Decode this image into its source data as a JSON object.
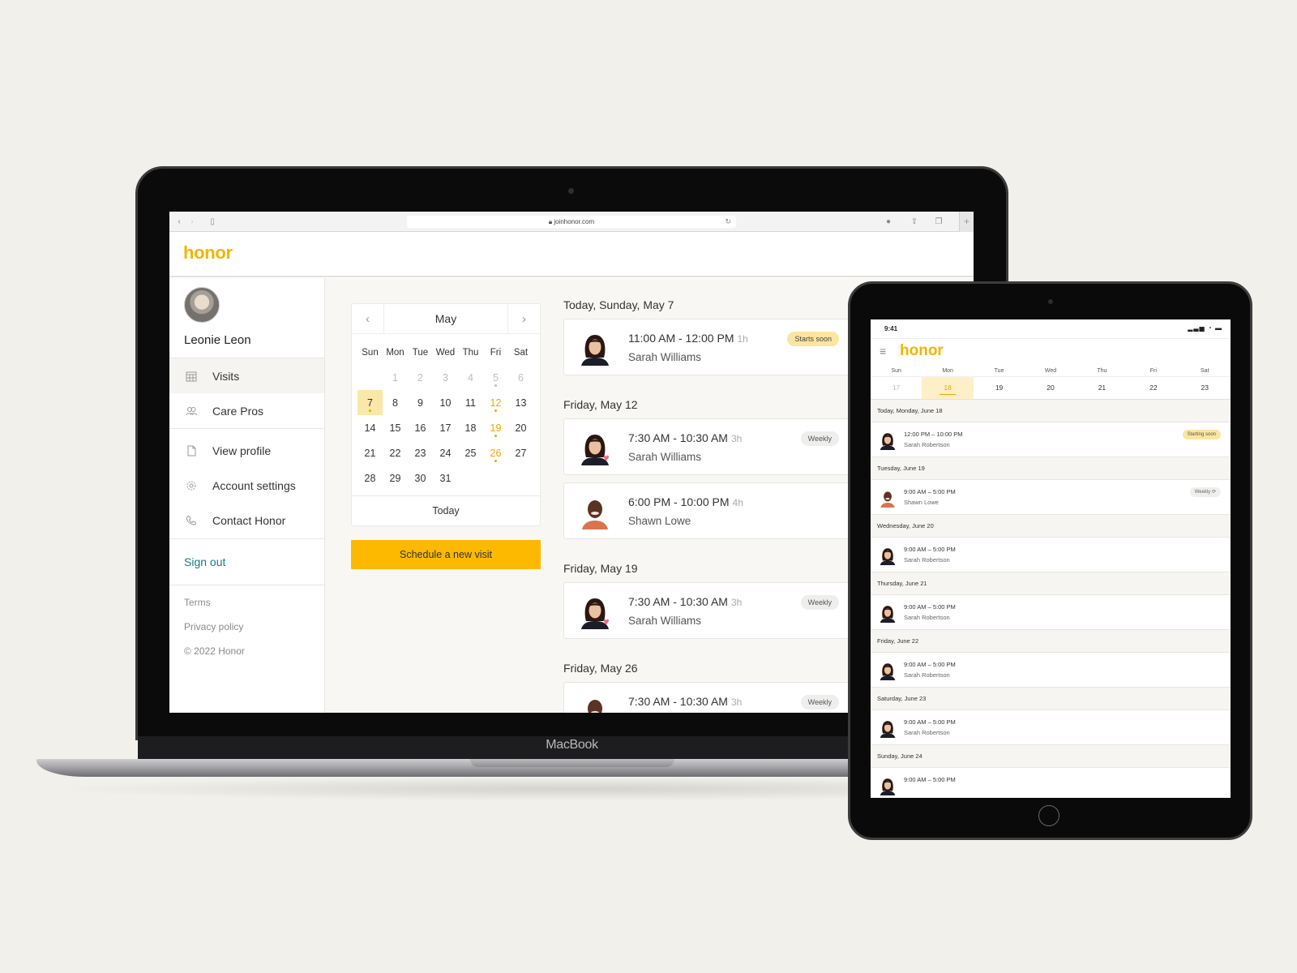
{
  "laptop": {
    "brand_label": "MacBook",
    "browser": {
      "url": "joinhonor.com",
      "lock_icon": "lock-icon",
      "back_icon": "chevron-left-icon",
      "forward_icon": "chevron-right-icon",
      "sidebar_icon": "sidebar-icon",
      "reload_icon": "reload-icon",
      "download_icon": "download-icon",
      "share_icon": "share-icon",
      "tabs_icon": "tabs-icon",
      "new_tab": "+"
    },
    "app": {
      "logo": "honor",
      "brand_color": "#f5b400",
      "user": {
        "name": "Leonie Leon"
      },
      "nav_primary": [
        {
          "label": "Visits",
          "icon": "calendar-icon",
          "active": true
        },
        {
          "label": "Care Pros",
          "icon": "people-icon",
          "active": false
        }
      ],
      "nav_secondary": [
        {
          "label": "View profile",
          "icon": "document-icon"
        },
        {
          "label": "Account settings",
          "icon": "gear-icon"
        },
        {
          "label": "Contact Honor",
          "icon": "phone-icon"
        }
      ],
      "sign_out": "Sign out",
      "footer": {
        "terms": "Terms",
        "privacy": "Privacy policy",
        "copyright": "© 2022 Honor"
      },
      "calendar": {
        "month": "May",
        "prev": "‹",
        "next": "›",
        "weekdays": [
          "Sun",
          "Mon",
          "Tue",
          "Wed",
          "Thu",
          "Fri",
          "Sat"
        ],
        "today_label": "Today",
        "selected_day": 7,
        "visit_days": [
          7,
          12,
          19,
          26
        ],
        "past_visit_days": [
          5
        ]
      },
      "schedule_button": "Schedule a new visit",
      "visit_days": [
        {
          "label": "Today, Sunday, May 7",
          "visits": [
            {
              "time": "11:00 AM - 12:00 PM",
              "duration": "1h",
              "carepro": "Sarah Williams",
              "badge": "Starts soon",
              "badge_type": "soon",
              "favorite": false,
              "avatar": "f"
            }
          ]
        },
        {
          "label": "Friday, May 12",
          "visits": [
            {
              "time": "7:30 AM - 10:30 AM",
              "duration": "3h",
              "carepro": "Sarah Williams",
              "badge": "Weekly",
              "badge_type": "weekly",
              "favorite": true,
              "avatar": "f"
            },
            {
              "time": "6:00 PM - 10:00 PM",
              "duration": "4h",
              "carepro": "Shawn Lowe",
              "badge": "",
              "badge_type": "",
              "favorite": false,
              "avatar": "m"
            }
          ]
        },
        {
          "label": "Friday, May 19",
          "visits": [
            {
              "time": "7:30 AM - 10:30 AM",
              "duration": "3h",
              "carepro": "Sarah Williams",
              "badge": "Weekly",
              "badge_type": "weekly",
              "favorite": true,
              "avatar": "f"
            }
          ]
        },
        {
          "label": "Friday, May 26",
          "visits": [
            {
              "time": "7:30 AM - 10:30 AM",
              "duration": "3h",
              "carepro": "",
              "badge": "Weekly",
              "badge_type": "weekly",
              "favorite": false,
              "avatar": "m"
            }
          ]
        }
      ]
    }
  },
  "tablet": {
    "status_time": "9:41",
    "status_icons": "signal-icon wifi-icon battery-icon",
    "logo": "honor",
    "menu_icon": "hamburger-icon",
    "week": {
      "weekdays": [
        "Sun",
        "Mon",
        "Tue",
        "Wed",
        "Thu",
        "Fri",
        "Sat"
      ],
      "dates": [
        17,
        18,
        19,
        20,
        21,
        22,
        23
      ],
      "selected": 18
    },
    "days": [
      {
        "label": "Today, Monday, June 18",
        "time": "12:00 PM – 10:00 PM",
        "carepro": "Sarah Robertson",
        "badge": "Starting soon",
        "badge_type": "soon",
        "avatar": "f"
      },
      {
        "label": "Tuesday, June 19",
        "time": "9:00 AM – 5:00 PM",
        "carepro": "Shawn Lowe",
        "badge": "Weekly ⟳",
        "badge_type": "weekly",
        "avatar": "m"
      },
      {
        "label": "Wednesday, June 20",
        "time": "9:00 AM – 5:00 PM",
        "carepro": "Sarah Robertson",
        "badge": "",
        "badge_type": "",
        "avatar": "f"
      },
      {
        "label": "Thursday, June 21",
        "time": "9:00 AM – 5:00 PM",
        "carepro": "Sarah Robertson",
        "badge": "",
        "badge_type": "",
        "avatar": "f"
      },
      {
        "label": "Friday, June 22",
        "time": "9:00 AM – 5:00 PM",
        "carepro": "Sarah Robertson",
        "badge": "",
        "badge_type": "",
        "avatar": "f"
      },
      {
        "label": "Saturday, June 23",
        "time": "9:00 AM – 5:00 PM",
        "carepro": "Sarah Robertson",
        "badge": "",
        "badge_type": "",
        "avatar": "f"
      },
      {
        "label": "Sunday, June 24",
        "time": "9:00 AM – 5:00 PM",
        "carepro": "",
        "badge": "",
        "badge_type": "",
        "avatar": "f"
      }
    ]
  }
}
